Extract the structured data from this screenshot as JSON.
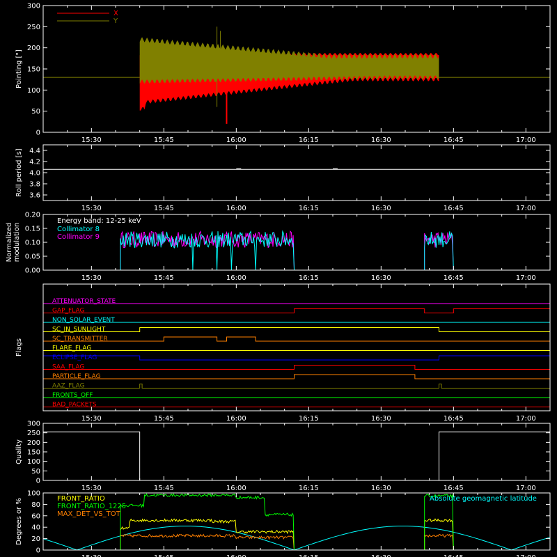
{
  "chart_data": [
    {
      "type": "line",
      "id": "pointing",
      "ylabel": "Pointing [\"]",
      "ylim": [
        0,
        300
      ],
      "yticks": [
        0,
        50,
        100,
        150,
        200,
        250,
        300
      ],
      "legend_position": "top-left",
      "x_time_range": [
        "15:20",
        "17:05"
      ],
      "series": [
        {
          "name": "X",
          "color": "#ff0000",
          "hold_value": 130,
          "active_range": [
            "15:40",
            "16:42"
          ],
          "upper": 185,
          "lower": 95,
          "min_start": 70,
          "lower_end": 125,
          "spike_time": "15:58",
          "spike_value": 10
        },
        {
          "name": "Y",
          "color": "#808000",
          "hold_value": 130,
          "active_range": [
            "15:40",
            "16:42"
          ],
          "upper_start": 220,
          "upper_end": 180,
          "lower": 120,
          "spike_time": "15:56",
          "spike_value": 250
        }
      ]
    },
    {
      "type": "line",
      "id": "roll",
      "ylabel": "Roll period [s]",
      "ylim": [
        3.5,
        4.5
      ],
      "yticks": [
        "3.6",
        "3.8",
        "4.0",
        "4.2",
        "4.4"
      ],
      "series": [
        {
          "name": "",
          "color": "#ffffff",
          "value": 4.06
        }
      ]
    },
    {
      "type": "line",
      "id": "modulation",
      "ylabel": [
        "Normalized",
        "modulation"
      ],
      "ylim": [
        0,
        0.2
      ],
      "yticks": [
        "0.00",
        "0.05",
        "0.10",
        "0.15",
        "0.20"
      ],
      "annotation": "Energy band: 12-25 keV",
      "legend_position": "top-left",
      "active_ranges": [
        [
          "15:36",
          "16:12"
        ],
        [
          "16:39",
          "16:45"
        ]
      ],
      "series": [
        {
          "name": "Collimator 8",
          "color": "#00ffff",
          "mean": 0.11,
          "dropouts": [
            "15:51",
            "15:56",
            "15:59",
            "16:04"
          ]
        },
        {
          "name": "Collimator 9",
          "color": "#ff00ff",
          "mean": 0.11
        }
      ]
    },
    {
      "type": "line",
      "id": "flags",
      "ylabel": "Flags",
      "flags": [
        {
          "name": "ATTENUATOR_STATE",
          "color": "#ff00ff",
          "steps": []
        },
        {
          "name": "GAP_FLAG",
          "color": "#ff0000",
          "steps": [
            [
              "16:12",
              1
            ],
            [
              "16:39",
              0
            ],
            [
              "16:45",
              1
            ]
          ]
        },
        {
          "name": "NON_SOLAR_EVENT",
          "color": "#00ffff",
          "steps": []
        },
        {
          "name": "SC_IN_SUNLIGHT",
          "color": "#ffff00",
          "steps": [
            [
              "15:40",
              1
            ],
            [
              "16:42",
              0
            ]
          ]
        },
        {
          "name": "SC_TRANSMITTER",
          "color": "#ff8000",
          "steps": [
            [
              "15:45",
              1
            ],
            [
              "15:56",
              0
            ],
            [
              "15:58",
              1
            ],
            [
              "16:04",
              0
            ]
          ]
        },
        {
          "name": "FLARE_FLAG",
          "color": "#ffff00",
          "steps": []
        },
        {
          "name": "ECLIPSE_FLAG",
          "color": "#0000ff",
          "initial": 1,
          "steps": [
            [
              "15:40",
              0
            ],
            [
              "16:42",
              1
            ]
          ]
        },
        {
          "name": "SAA_FLAG",
          "color": "#ff0000",
          "steps": [
            [
              "16:12",
              1
            ],
            [
              "16:37",
              0
            ]
          ]
        },
        {
          "name": "PARTICLE_FLAG",
          "color": "#ff8000",
          "steps": [
            [
              "16:12",
              1
            ],
            [
              "16:37",
              0
            ]
          ]
        },
        {
          "name": "AAZ_FLAG",
          "color": "#808000",
          "steps": [
            [
              "15:40",
              1
            ],
            [
              "15:40.5",
              0
            ],
            [
              "16:42",
              1
            ],
            [
              "16:42.5",
              0
            ]
          ]
        },
        {
          "name": "FRONTS_OFF",
          "color": "#00ff00",
          "steps": []
        },
        {
          "name": "BAD_PACKETS",
          "color": "#ff0000",
          "steps": []
        }
      ]
    },
    {
      "type": "line",
      "id": "quality",
      "ylabel": "Quality",
      "ylim": [
        0,
        300
      ],
      "yticks": [
        0,
        50,
        100,
        150,
        200,
        250,
        300
      ],
      "series": [
        {
          "name": "",
          "color": "#ffffff",
          "high": 255,
          "low": 0,
          "low_range": [
            "15:40",
            "16:42"
          ]
        }
      ]
    },
    {
      "type": "line",
      "id": "degrees",
      "ylabel": "Degrees or %",
      "ylim": [
        0,
        100
      ],
      "yticks": [
        0,
        20,
        40,
        60,
        80,
        100
      ],
      "active_ranges": [
        [
          "15:36",
          "16:12"
        ],
        [
          "16:39",
          "16:45"
        ]
      ],
      "series": [
        {
          "name": "FRONT_RATIO",
          "color": "#ffff00",
          "segments": [
            [
              "15:36",
              "15:38",
              38
            ],
            [
              "15:38",
              "15:55",
              52
            ],
            [
              "15:55",
              "16:00",
              50
            ],
            [
              "16:00",
              "16:12",
              32
            ],
            [
              "16:39",
              "16:45",
              52
            ]
          ]
        },
        {
          "name": "FRONT_RATIO_1225",
          "color": "#00ff00",
          "segments": [
            [
              "15:36",
              "15:41",
              78
            ],
            [
              "15:41",
              "16:00",
              96
            ],
            [
              "16:00",
              "16:06",
              92
            ],
            [
              "16:06",
              "16:12",
              62
            ],
            [
              "16:39",
              "16:45",
              95
            ]
          ]
        },
        {
          "name": "MAX_DET_VS_TOT",
          "color": "#ff8000",
          "segments": [
            [
              "15:36",
              "16:00",
              25
            ],
            [
              "16:00",
              "16:12",
              22
            ],
            [
              "16:39",
              "16:45",
              25
            ]
          ]
        },
        {
          "name": "Absolute geomagnetic latitude",
          "color": "#00ffff",
          "wave": {
            "min": 0,
            "max": 42,
            "zeros": [
              "15:27",
              "16:12",
              "16:58"
            ]
          }
        }
      ]
    }
  ],
  "xticks": [
    "15:30",
    "15:45",
    "16:00",
    "16:15",
    "16:30",
    "16:45",
    "17:00"
  ]
}
